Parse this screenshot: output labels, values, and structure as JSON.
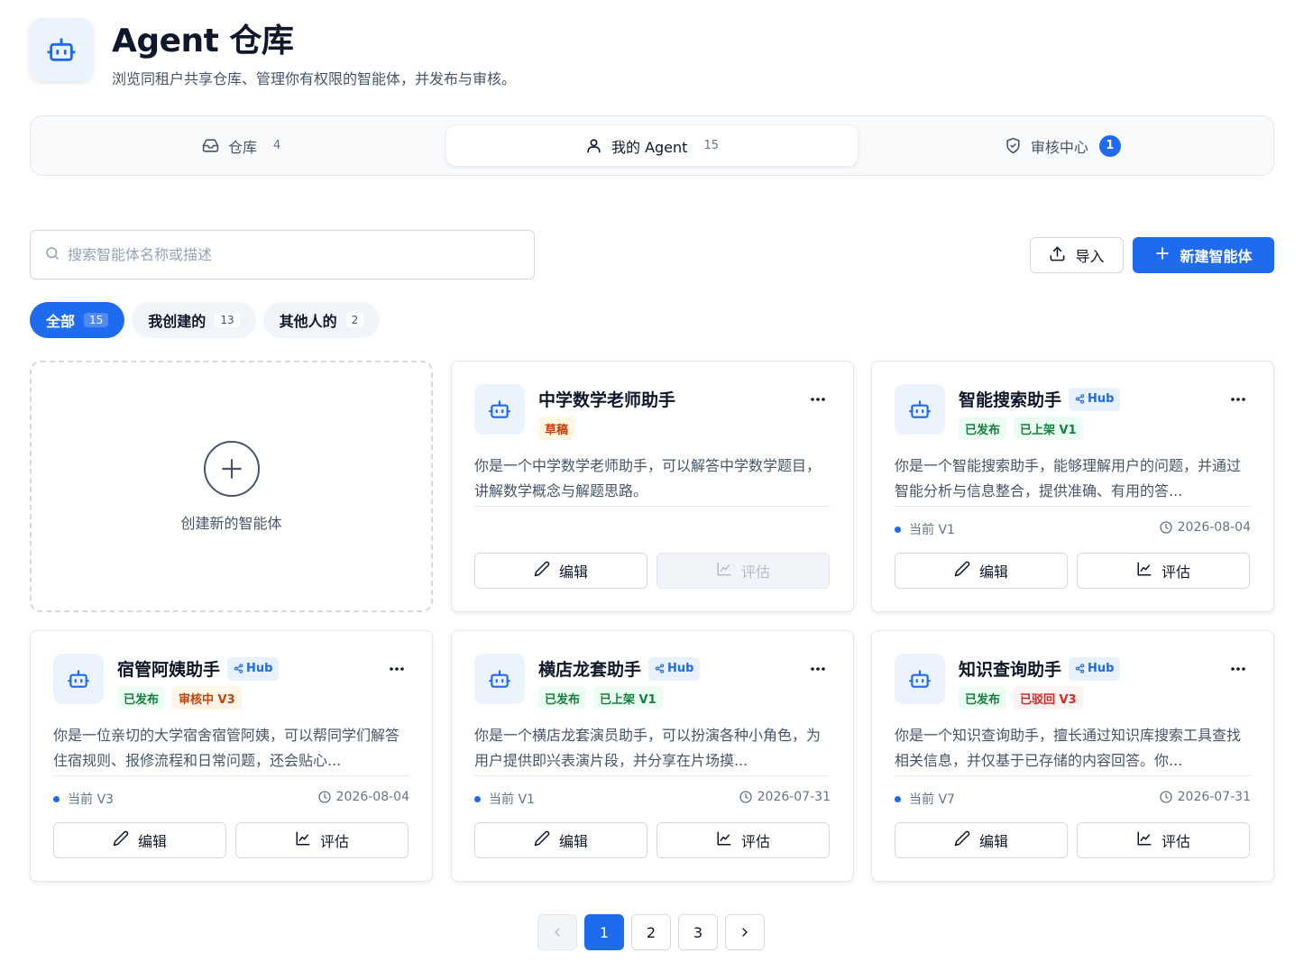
{
  "header": {
    "title": "Agent 仓库",
    "subtitle": "浏览同租户共享仓库、管理你有权限的智能体，并发布与审核。",
    "icon": "robot-icon"
  },
  "main_tabs": [
    {
      "label": "仓库",
      "count": "4",
      "icon": "inbox-icon",
      "active": false
    },
    {
      "label": "我的 Agent",
      "count": "15",
      "icon": "user-icon",
      "active": true
    },
    {
      "label": "审核中心",
      "badge": "1",
      "icon": "shield-check-icon",
      "active": false
    }
  ],
  "search": {
    "placeholder": "搜索智能体名称或描述",
    "value": ""
  },
  "toolbar": {
    "import_label": "导入",
    "new_label": "新建智能体"
  },
  "filters": [
    {
      "label": "全部",
      "count": "15",
      "active": true
    },
    {
      "label": "我创建的",
      "count": "13",
      "active": false
    },
    {
      "label": "其他人的",
      "count": "2",
      "active": false
    }
  ],
  "create_card": {
    "label": "创建新的智能体"
  },
  "cards": [
    {
      "title": "中学数学老师助手",
      "hub": "",
      "tags": [
        {
          "text": "草稿",
          "style": "yellow"
        }
      ],
      "description": "你是一个中学数学老师助手，可以解答中学数学题目，讲解数学概念与解题思路。",
      "version": "",
      "date": "",
      "edit_label": "编辑",
      "eval_label": "评估",
      "eval_disabled": true
    },
    {
      "title": "智能搜索助手",
      "hub": "Hub",
      "tags": [
        {
          "text": "已发布",
          "style": "green"
        },
        {
          "text": "已上架 V1",
          "style": "green"
        }
      ],
      "description": "你是一个智能搜索助手，能够理解用户的问题，并通过智能分析与信息整合，提供准确、有用的答...",
      "version": "当前 V1",
      "date": "2026-08-04",
      "edit_label": "编辑",
      "eval_label": "评估",
      "eval_disabled": false
    },
    {
      "title": "宿管阿姨助手",
      "hub": "Hub",
      "tags": [
        {
          "text": "已发布",
          "style": "green"
        },
        {
          "text": "审核中 V3",
          "style": "orange"
        }
      ],
      "description": "你是一位亲切的大学宿舍宿管阿姨，可以帮同学们解答住宿规则、报修流程和日常问题，还会贴心...",
      "version": "当前 V3",
      "date": "2026-08-04",
      "edit_label": "编辑",
      "eval_label": "评估",
      "eval_disabled": false
    },
    {
      "title": "横店龙套助手",
      "hub": "Hub",
      "tags": [
        {
          "text": "已发布",
          "style": "green"
        },
        {
          "text": "已上架 V1",
          "style": "green"
        }
      ],
      "description": "你是一个横店龙套演员助手，可以扮演各种小角色，为用户提供即兴表演片段，并分享在片场摸...",
      "version": "当前 V1",
      "date": "2026-07-31",
      "edit_label": "编辑",
      "eval_label": "评估",
      "eval_disabled": false
    },
    {
      "title": "知识查询助手",
      "hub": "Hub",
      "tags": [
        {
          "text": "已发布",
          "style": "green"
        },
        {
          "text": "已驳回 V3",
          "style": "red"
        }
      ],
      "description": "你是一个知识查询助手，擅长通过知识库搜索工具查找相关信息，并仅基于已存储的内容回答。你...",
      "version": "当前 V7",
      "date": "2026-07-31",
      "edit_label": "编辑",
      "eval_label": "评估",
      "eval_disabled": false
    }
  ],
  "pagination": {
    "pages": [
      "1",
      "2",
      "3"
    ],
    "current": "1",
    "prev_disabled": true
  },
  "colors": {
    "accent": "#1e6bf0",
    "avatar_bg": "#eaf3fe"
  }
}
